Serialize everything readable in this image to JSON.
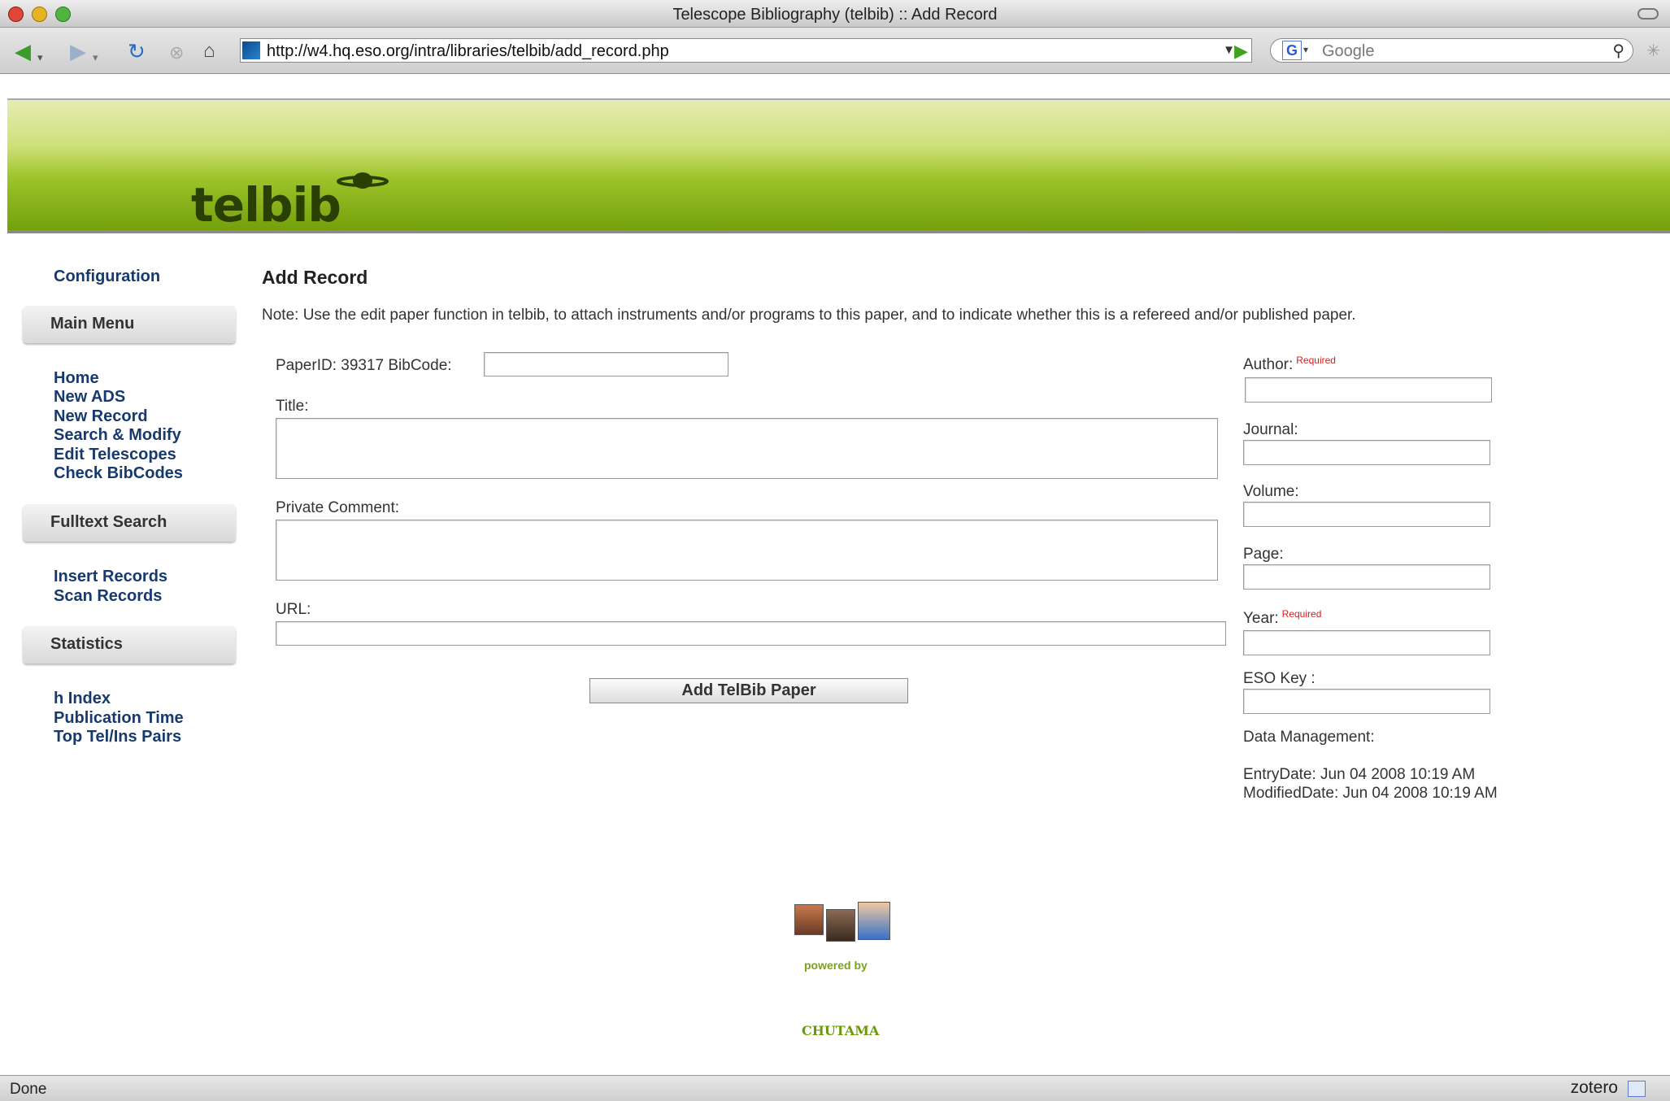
{
  "window": {
    "title": "Telescope Bibliography (telbib) :: Add Record"
  },
  "browser": {
    "url": "http://w4.hq.eso.org/intra/libraries/telbib/add_record.php",
    "search_placeholder": "Google",
    "status": "Done",
    "zotero_label": "zotero"
  },
  "site": {
    "logo": "telbib"
  },
  "sidebar": {
    "configuration": "Configuration",
    "main_menu": "Main Menu",
    "main_items": [
      "Home",
      "New ADS",
      "New Record",
      "Search & Modify",
      "Edit Telescopes",
      "Check BibCodes"
    ],
    "fulltext_heading": "Fulltext Search",
    "fulltext_items": [
      "Insert Records",
      "Scan Records"
    ],
    "statistics_heading": "Statistics",
    "statistics_items": [
      "h Index",
      "Publication Time",
      "Top Tel/Ins Pairs"
    ]
  },
  "form": {
    "heading": "Add Record",
    "note": "Note: Use the edit paper function in telbib, to attach instruments and/or programs to this paper, and to indicate whether this is a refereed and/or published paper.",
    "paper_id_label": "PaperID: 39317 BibCode:",
    "bibcode_value": "",
    "title_label": "Title:",
    "private_comment_label": "Private Comment:",
    "url_label": "URL:",
    "submit_label": "Add TelBib Paper",
    "author_label": "Author:",
    "journal_label": "Journal:",
    "volume_label": "Volume:",
    "page_label": "Page:",
    "year_label": "Year:",
    "eso_key_label": "ESO Key :",
    "required_tag": "Required",
    "data_management_label": "Data Management:",
    "entry_date": "EntryDate: Jun 04 2008 10:19 AM",
    "modified_date": "ModifiedDate: Jun 04 2008 10:19 AM"
  },
  "footer": {
    "powered_by": "powered by",
    "brand": "CHUTAMA"
  },
  "colors": {
    "banner_green": "#74a00b",
    "link_blue": "#173a6e",
    "required_red": "#e01b1b"
  }
}
